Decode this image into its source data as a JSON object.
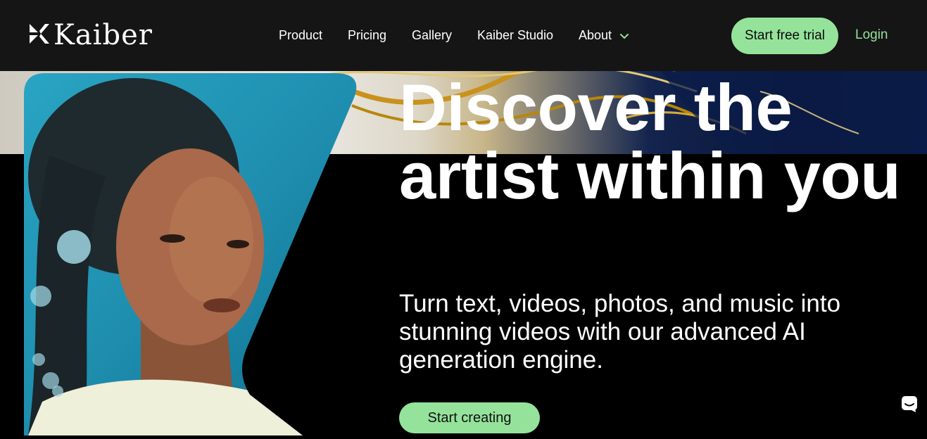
{
  "nav": {
    "brand": "Kaiber",
    "links": [
      "Product",
      "Pricing",
      "Gallery",
      "Kaiber Studio",
      "About"
    ],
    "trial_label": "Start free trial",
    "login_label": "Login"
  },
  "hero": {
    "title": "Discover the artist within you",
    "subtitle": "Turn text, videos, photos, and music into stunning videos with our advanced AI generation engine.",
    "cta_label": "Start creating"
  },
  "colors": {
    "accent": "#95e39b",
    "nav_bg": "#151515",
    "hero_bg": "#000000"
  },
  "icons": {
    "brand_mark": "kaiber-logo-icon",
    "about_caret": "chevron-down-icon",
    "chat": "chat-bubble-icon"
  }
}
